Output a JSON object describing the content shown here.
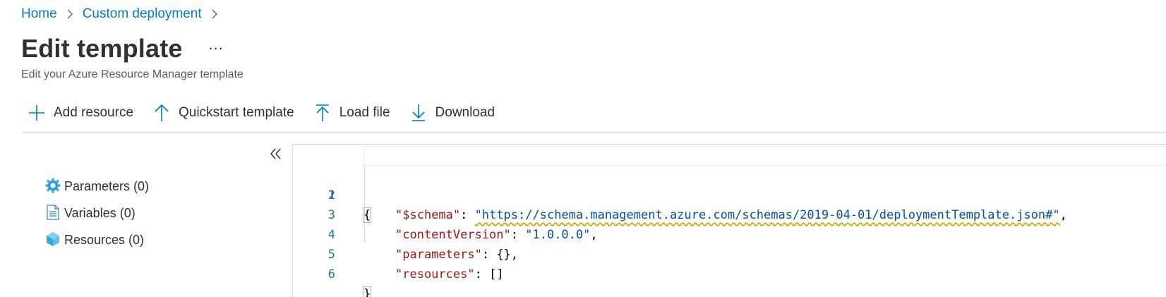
{
  "breadcrumb": {
    "items": [
      "Home",
      "Custom deployment"
    ]
  },
  "header": {
    "title": "Edit template",
    "more": "…",
    "subtitle": "Edit your Azure Resource Manager template"
  },
  "toolbar": {
    "add_resource": "Add resource",
    "quickstart": "Quickstart template",
    "load_file": "Load file",
    "download": "Download"
  },
  "sidebar": {
    "items": [
      {
        "label": "Parameters (0)",
        "icon": "gear-icon"
      },
      {
        "label": "Variables (0)",
        "icon": "document-icon"
      },
      {
        "label": "Resources (0)",
        "icon": "cube-icon"
      }
    ]
  },
  "editor": {
    "lines": [
      {
        "num": "1",
        "open": "{"
      },
      {
        "num": "2",
        "key": "\"$schema\"",
        "value": "\"https://schema.management.azure.com/schemas/2019-04-01/deploymentTemplate.json#\"",
        "tail": ","
      },
      {
        "num": "3",
        "key": "\"contentVersion\"",
        "value": "\"1.0.0.0\"",
        "tail": ","
      },
      {
        "num": "4",
        "key": "\"parameters\"",
        "value": "{}",
        "tail": ","
      },
      {
        "num": "5",
        "key": "\"resources\"",
        "value": "[]",
        "tail": ""
      },
      {
        "num": "6",
        "open": "}"
      }
    ]
  },
  "colors": {
    "link": "#0078d4",
    "key": "#a31515",
    "string": "#0451a5",
    "line_number": "#237893"
  }
}
